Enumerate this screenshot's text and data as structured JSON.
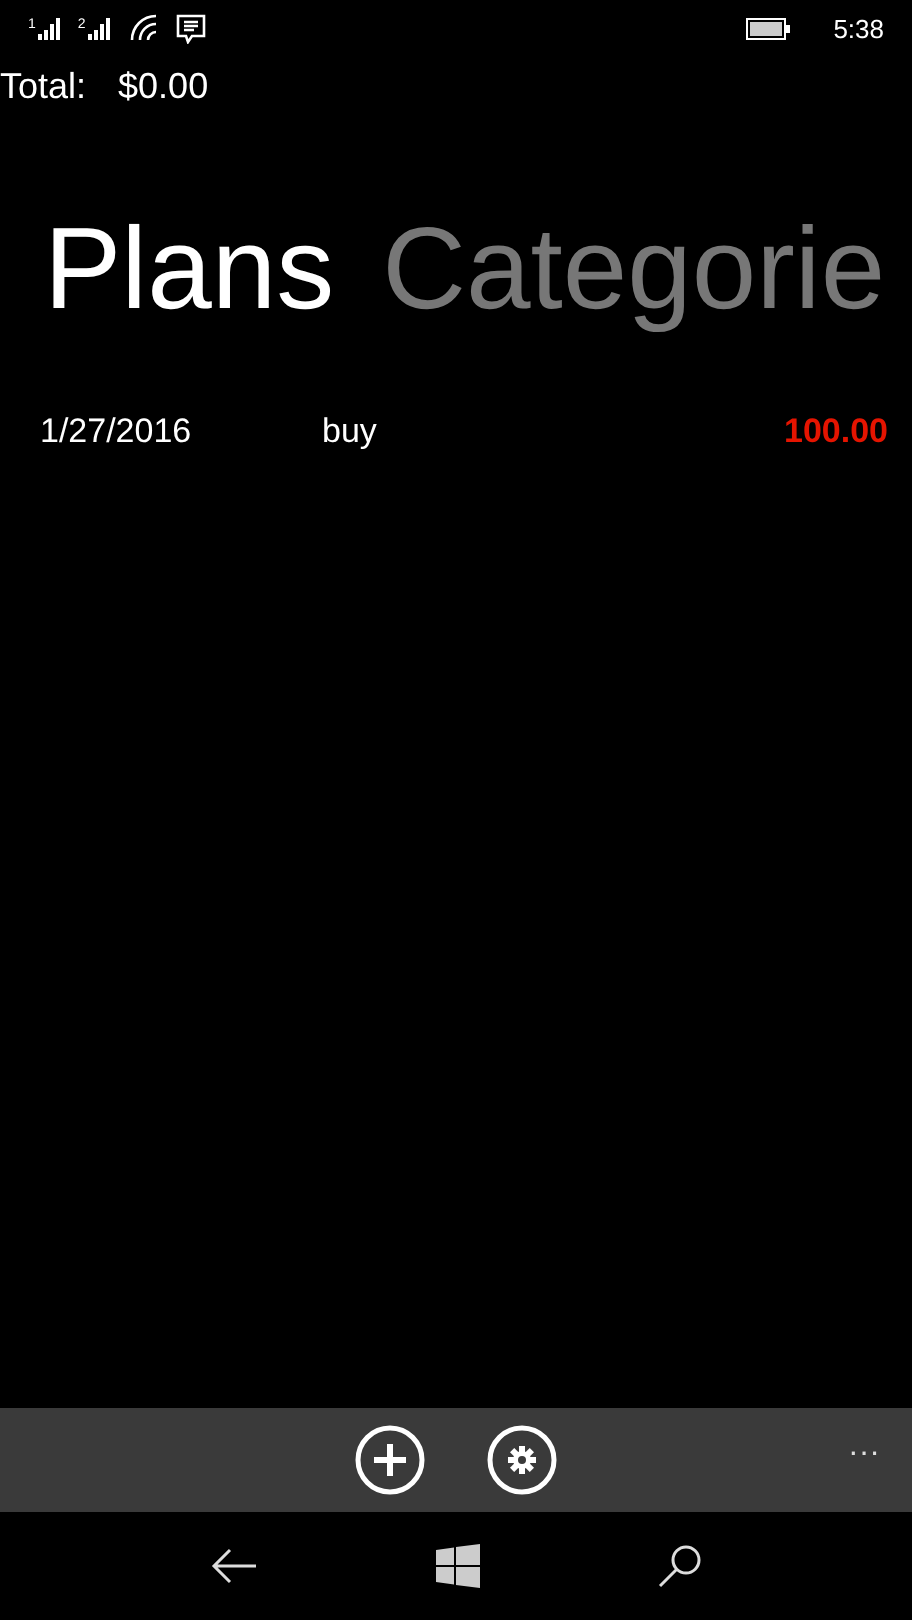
{
  "status_bar": {
    "sims": [
      {
        "label": "1"
      },
      {
        "label": "2"
      }
    ],
    "time": "5:38"
  },
  "total": {
    "label": "Total:",
    "value": "$0.00"
  },
  "pivot": [
    {
      "label": "Plans",
      "selected": true
    },
    {
      "label": "Categorie",
      "selected": false
    }
  ],
  "rows": [
    {
      "date": "1/27/2016",
      "description": "buy",
      "amount": "100.00",
      "kind": "expense"
    }
  ],
  "app_bar": {
    "buttons": [
      {
        "kind": "add"
      },
      {
        "kind": "settings"
      }
    ],
    "more": "···"
  }
}
